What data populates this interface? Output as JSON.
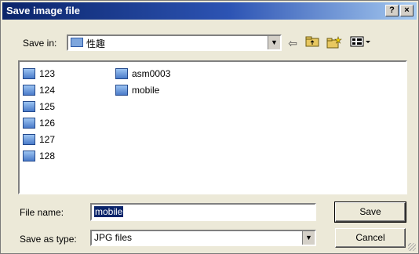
{
  "window": {
    "title": "Save image file"
  },
  "titlebar": {
    "help_label": "?",
    "close_label": "×"
  },
  "save_in": {
    "label": "Save in:",
    "folder": "性趣"
  },
  "toolbar": {
    "back_icon": "back-arrow-icon",
    "up_icon": "folder-up-icon",
    "new_folder_icon": "new-folder-icon",
    "view_icon": "view-menu-icon"
  },
  "files": {
    "col1": [
      "123",
      "124",
      "125",
      "126",
      "127",
      "128"
    ],
    "col2": [
      "asm0003",
      "mobile"
    ]
  },
  "file_name": {
    "label": "File name:",
    "value": "mobile"
  },
  "save_as_type": {
    "label": "Save as type:",
    "value": "JPG files"
  },
  "buttons": {
    "save": "Save",
    "cancel": "Cancel"
  },
  "colors": {
    "titlebar": "#0a246a",
    "selection": "#0a246a",
    "background": "#ece9d8"
  }
}
